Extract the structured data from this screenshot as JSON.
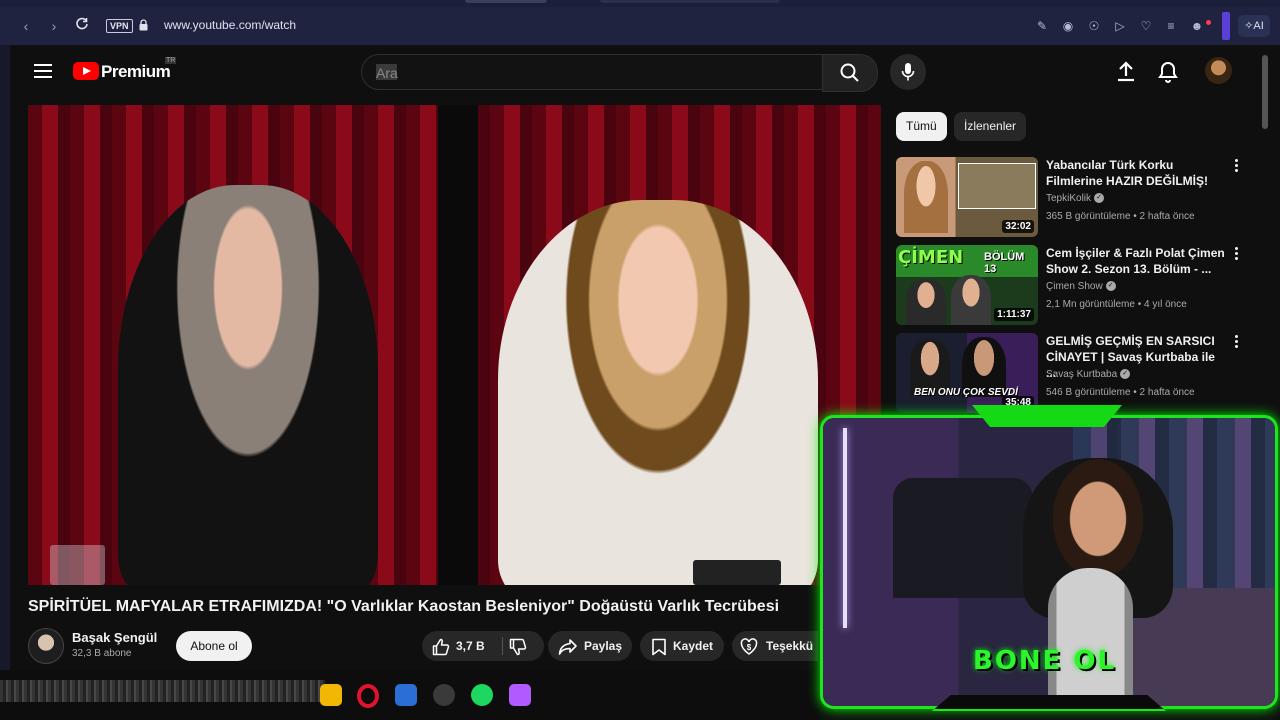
{
  "browser": {
    "vpn_label": "VPN",
    "url": "www.youtube.com/watch",
    "ai_label": "AI"
  },
  "header": {
    "logo_text": "Premium",
    "logo_region": "TR",
    "search_placeholder": "Ara"
  },
  "video": {
    "title": "SPİRİTÜEL MAFYALAR ETRAFIMIZDA! \"O Varlıklar Kaostan Besleniyor\" Doğaüstü Varlık Tecrübesi",
    "channel": "Başak Şengül",
    "subscribers": "32,3 B abone",
    "subscribe_label": "Abone ol",
    "like_count": "3,7 B",
    "share_label": "Paylaş",
    "save_label": "Kaydet",
    "thanks_label": "Teşekkü"
  },
  "chips": [
    {
      "label": "Tümü",
      "active": true
    },
    {
      "label": "İzlenenler",
      "active": false
    }
  ],
  "recommendations": [
    {
      "title": "Yabancılar Türk Korku Filmlerine HAZIR DEĞİLMİŞ!",
      "channel": "TepkiKolik",
      "meta": "365 B görüntüleme • 2 hafta önce",
      "duration": "32:02"
    },
    {
      "title": "Cem İşçiler & Fazlı Polat Çimen Show 2. Sezon 13. Bölüm - ...",
      "channel": "Çimen Show",
      "meta": "2,1 Mn görüntüleme • 4 yıl önce",
      "duration": "1:11:37",
      "thumb_text": "ÇİMEN",
      "thumb_text2": "BÖLÜM 13"
    },
    {
      "title": "GELMİŞ GEÇMİŞ EN SARSICI CİNAYET | Savaş Kurtbaba ile ...",
      "channel": "Savaş Kurtbaba",
      "meta": "546 B görüntüleme • 2 hafta önce",
      "duration": "35:48",
      "thumb_text": "BEN ONU ÇOK SEVDİ"
    }
  ],
  "webcam": {
    "overlay_text": "BONE OL"
  },
  "colors": {
    "accent_green": "#1ee51e",
    "youtube_red": "#ff0000",
    "background": "#0f0f0f"
  }
}
